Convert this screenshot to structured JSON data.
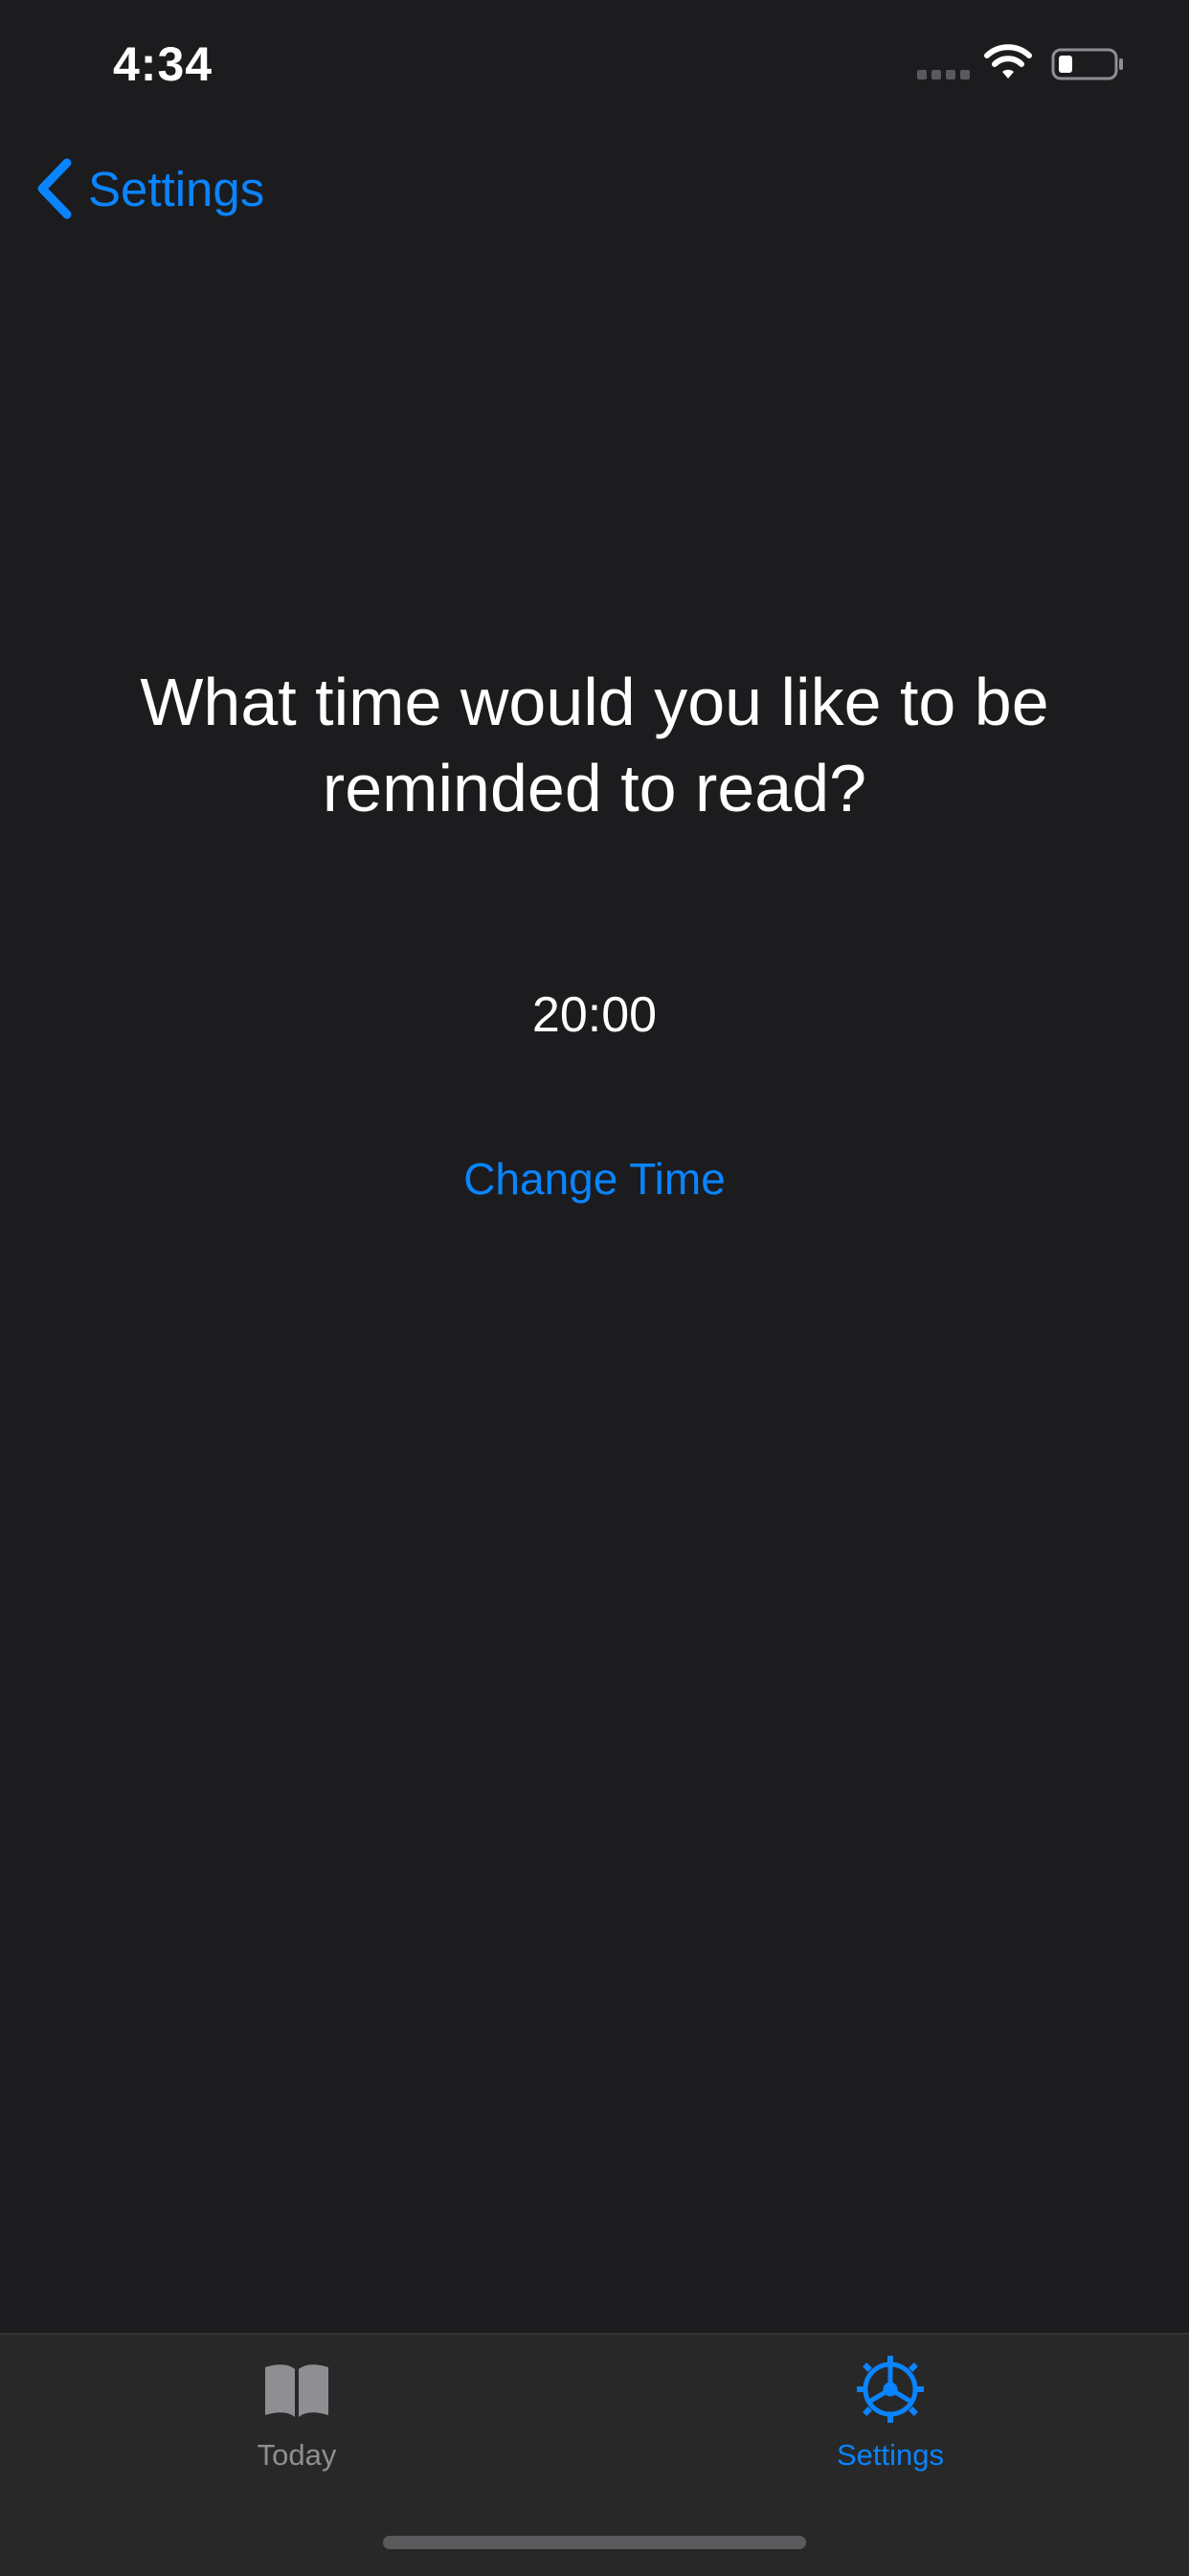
{
  "status_bar": {
    "time": "4:34"
  },
  "nav": {
    "back_label": "Settings"
  },
  "main": {
    "question": "What time would you like to be reminded to read?",
    "time_value": "20:00",
    "change_time_label": "Change Time"
  },
  "tab_bar": {
    "tabs": [
      {
        "label": "Today",
        "icon": "book-icon",
        "active": false
      },
      {
        "label": "Settings",
        "icon": "gear-icon",
        "active": true
      }
    ]
  },
  "colors": {
    "background": "#1c1c1e",
    "accent": "#0a84ff",
    "tab_bar_background": "#282828",
    "inactive_tab": "#8e8e93"
  }
}
